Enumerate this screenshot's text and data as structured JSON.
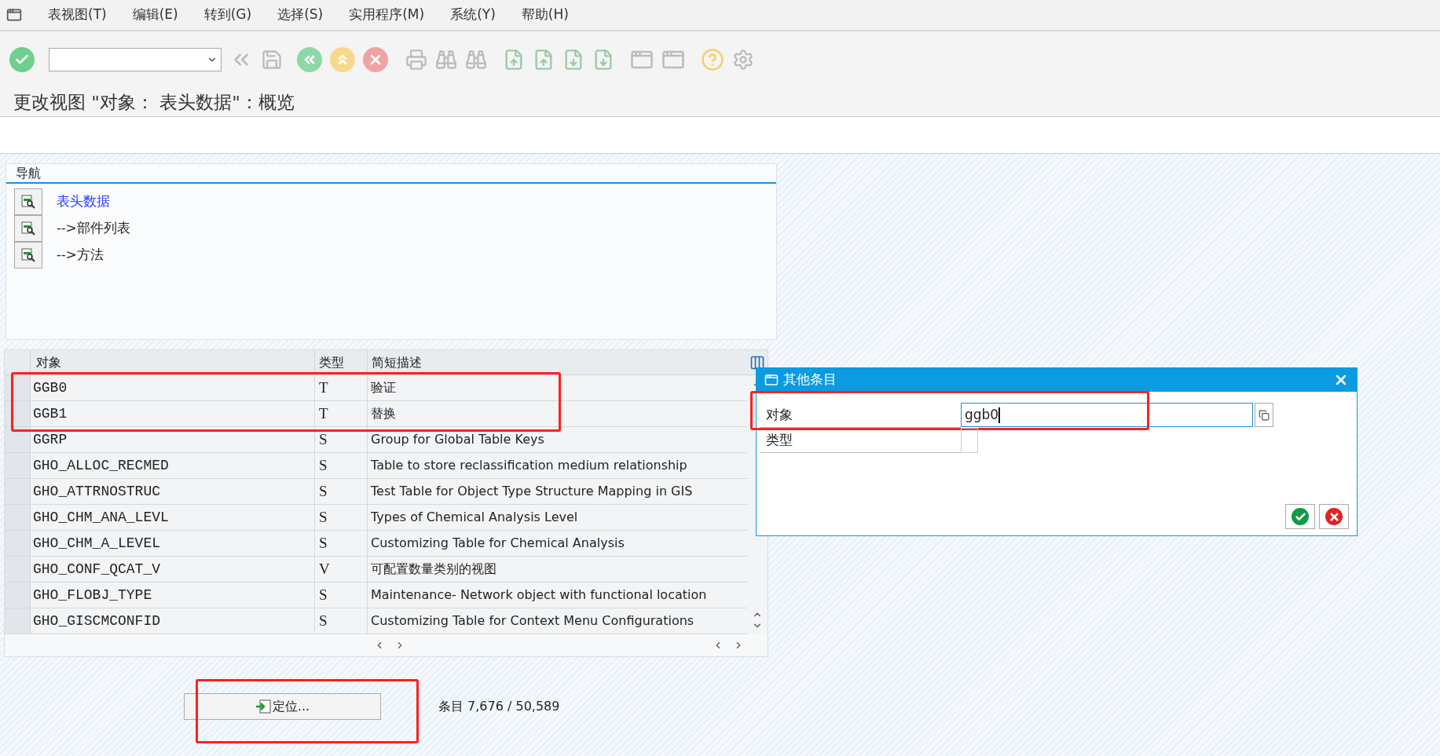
{
  "menu": [
    {
      "label": "表视图(T)"
    },
    {
      "label": "编辑(E)"
    },
    {
      "label": "转到(G)"
    },
    {
      "label": "选择(S)"
    },
    {
      "label": "实用程序(M)"
    },
    {
      "label": "系统(Y)"
    },
    {
      "label": "帮助(H)"
    }
  ],
  "title": "更改视图 \"对象： 表头数据\"：概览",
  "navigation": {
    "heading": "导航",
    "items": [
      {
        "label": "表头数据",
        "selected": true
      },
      {
        "label": "-->部件列表",
        "selected": false
      },
      {
        "label": "-->方法",
        "selected": false
      }
    ]
  },
  "table": {
    "columns": [
      "对象",
      "类型",
      "简短描述"
    ],
    "rows": [
      {
        "object": "GGB0",
        "type": "T",
        "description": "验证",
        "highlighted": true
      },
      {
        "object": "GGB1",
        "type": "T",
        "description": "替换",
        "highlighted": true
      },
      {
        "object": "GGRP",
        "type": "S",
        "description": "Group for Global Table Keys",
        "highlighted": false
      },
      {
        "object": "GHO_ALLOC_RECMED",
        "type": "S",
        "description": "Table to store reclassification medium relationship",
        "highlighted": false
      },
      {
        "object": "GHO_ATTRNOSTRUC",
        "type": "S",
        "description": "Test Table for Object Type Structure Mapping in GIS",
        "highlighted": false
      },
      {
        "object": "GHO_CHM_ANA_LEVL",
        "type": "S",
        "description": "Types of Chemical Analysis Level",
        "highlighted": false
      },
      {
        "object": "GHO_CHM_A_LEVEL",
        "type": "S",
        "description": "Customizing Table for Chemical Analysis",
        "highlighted": false
      },
      {
        "object": "GHO_CONF_QCAT_V",
        "type": "V",
        "description": "可配置数量类别的视图",
        "highlighted": false
      },
      {
        "object": "GHO_FLOBJ_TYPE",
        "type": "S",
        "description": "Maintenance- Network object with functional location",
        "highlighted": false
      },
      {
        "object": "GHO_GISCMCONFID",
        "type": "S",
        "description": "Customizing Table for Context Menu Configurations",
        "highlighted": false
      }
    ]
  },
  "locate_button": {
    "label": "定位...",
    "highlighted": true
  },
  "entries": "条目 7,676 / 50,589",
  "dialog": {
    "title": "其他条目",
    "fields": [
      {
        "label": "对象",
        "value": "ggb0",
        "highlighted": true
      },
      {
        "label": "类型",
        "highlighted": false
      }
    ]
  }
}
